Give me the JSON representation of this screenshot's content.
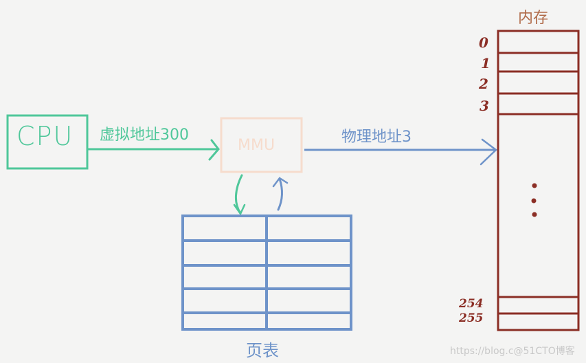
{
  "colors": {
    "cpu": "#4fc79a",
    "mmu": "#f6dccd",
    "page_table": "#6e93c9",
    "memory": "#8b2e25",
    "memory_title": "#b06a48",
    "background": "#f4f4f3"
  },
  "cpu": {
    "label": "CPU"
  },
  "mmu": {
    "label": "MMU"
  },
  "arrows": {
    "virtual_address_label": "虚拟地址300",
    "physical_address_label": "物理地址3"
  },
  "page_table": {
    "title": "页表",
    "rows": 5,
    "columns": 2
  },
  "memory": {
    "title": "内存",
    "row_labels_top": [
      "0",
      "1",
      "2",
      "3"
    ],
    "ellipsis": "⋮",
    "row_labels_bottom": [
      "254",
      "255"
    ]
  },
  "watermark": "https://blog.c@51CTO博客"
}
